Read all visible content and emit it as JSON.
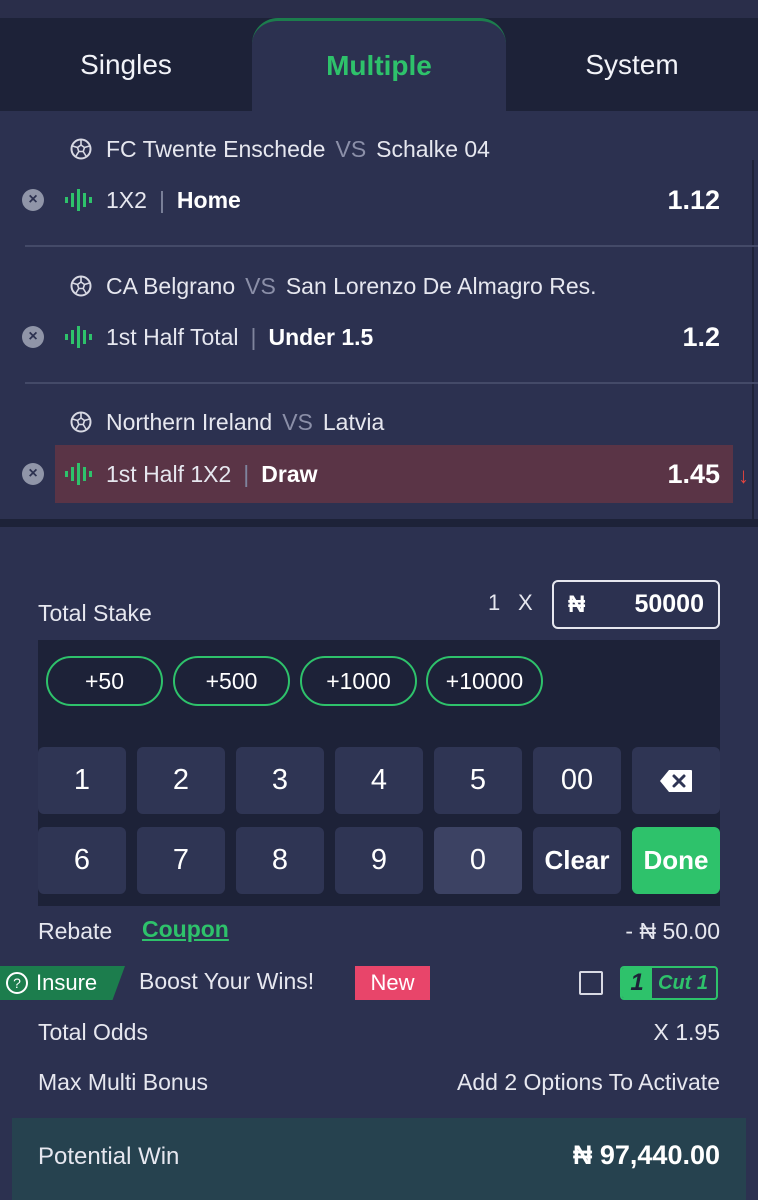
{
  "tabs": [
    {
      "label": "Singles"
    },
    {
      "label": "Multiple"
    },
    {
      "label": "System"
    }
  ],
  "active_tab": "Multiple",
  "bets": [
    {
      "home": "FC Twente Enschede",
      "vs": "VS",
      "away": "Schalke 04",
      "market": "1X2",
      "pick": "Home",
      "odds": "1.12"
    },
    {
      "home": "CA Belgrano",
      "vs": "VS",
      "away": "San Lorenzo De Almagro Res.",
      "market": "1st Half Total",
      "pick": "Under 1.5",
      "odds": "1.2"
    },
    {
      "home": "Northern Ireland",
      "vs": "VS",
      "away": "Latvia",
      "market": "1st Half 1X2",
      "pick": "Draw",
      "odds": "1.45",
      "odds_change": "down"
    }
  ],
  "stake": {
    "label": "Total Stake",
    "multiplier": "1",
    "times": "X",
    "currency": "₦",
    "amount": "50000"
  },
  "quick_amounts": [
    "+50",
    "+500",
    "+1000",
    "+10000"
  ],
  "keypad": {
    "row1": [
      "1",
      "2",
      "3",
      "4",
      "5",
      "00"
    ],
    "row2": [
      "6",
      "7",
      "8",
      "9",
      "0"
    ],
    "clear": "Clear",
    "done": "Done",
    "backspace_icon": "backspace-icon"
  },
  "rebate": {
    "label": "Rebate",
    "coupon": "Coupon",
    "value": "- ₦ 50.00"
  },
  "insure": {
    "tag": "Insure",
    "boost": "Boost Your Wins!",
    "badge": "New",
    "logo_one": "1",
    "logo_text": "Cut 1"
  },
  "total_odds": {
    "label": "Total Odds",
    "value": "X 1.95"
  },
  "max_bonus": {
    "label": "Max Multi Bonus",
    "value": "Add 2 Options To Activate"
  },
  "potential_win": {
    "label": "Potential Win",
    "value": "₦ 97,440.00"
  },
  "colors": {
    "accent": "#2ec26b",
    "background": "#2c3150",
    "dark": "#1d2238",
    "highlight": "#5a3446",
    "new_badge": "#e8456a",
    "down": "#e2443f"
  }
}
